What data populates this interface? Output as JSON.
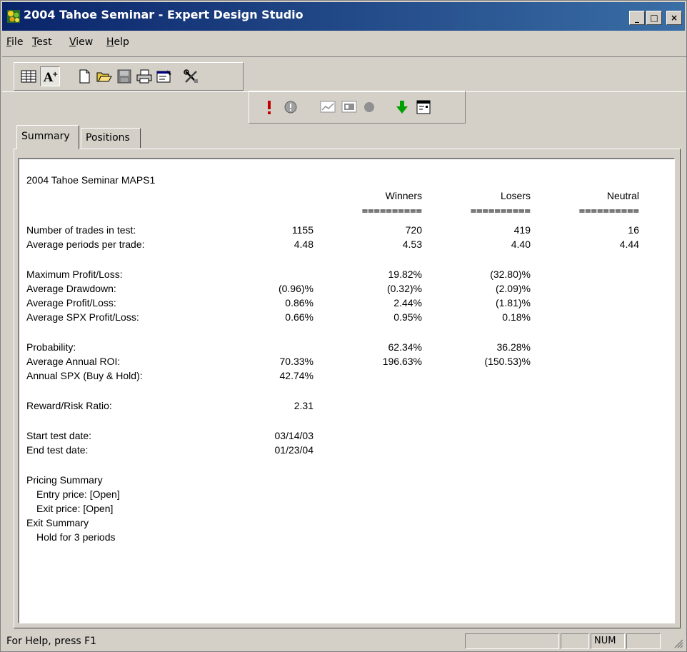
{
  "window": {
    "title": "2004 Tahoe Seminar - Expert Design Studio",
    "controls": {
      "minimize": "_",
      "maximize": "□",
      "close": "×"
    }
  },
  "menu": {
    "items": [
      {
        "label": "File",
        "mnemonic": "F",
        "rest": "ile"
      },
      {
        "label": "Test",
        "mnemonic": "T",
        "rest": "est"
      },
      {
        "label": "View",
        "mnemonic": "V",
        "rest": "iew"
      },
      {
        "label": "Help",
        "mnemonic": "H",
        "rest": "elp"
      }
    ]
  },
  "toolbar1": {
    "icons": [
      "grid-view-icon",
      "text-view-icon",
      "new-file-icon",
      "open-folder-icon",
      "save-icon",
      "print-icon",
      "properties-icon",
      "tools-icon"
    ]
  },
  "toolbar2": {
    "icons": [
      "run-alert-icon",
      "stop-icon",
      "chart-icon",
      "chart-window-icon",
      "record-icon",
      "download-arrow-icon",
      "report-icon"
    ],
    "colors": {
      "alert": "#c00000",
      "arrow": "#00a000"
    }
  },
  "tabs": [
    {
      "label": "Summary",
      "active": true
    },
    {
      "label": "Positions",
      "active": false
    }
  ],
  "report": {
    "title": "2004 Tahoe Seminar MAPS1",
    "headers": {
      "winners": "Winners",
      "losers": "Losers",
      "neutral": "Neutral"
    },
    "separator": "==========",
    "rows": {
      "trades": {
        "label": "Number of trades in test:",
        "all": "1155",
        "winners": "720",
        "losers": "419",
        "neutral": "16"
      },
      "periods": {
        "label": "Average periods per trade:",
        "all": "4.48",
        "winners": "4.53",
        "losers": "4.40",
        "neutral": "4.44"
      },
      "max_pl": {
        "label": "Maximum Profit/Loss:",
        "winners": "19.82%",
        "losers": "(32.80)%"
      },
      "avg_dd": {
        "label": "Average Drawdown:",
        "all": "(0.96)%",
        "winners": "(0.32)%",
        "losers": "(2.09)%"
      },
      "avg_pl": {
        "label": "Average Profit/Loss:",
        "all": "0.86%",
        "winners": "2.44%",
        "losers": "(1.81)%"
      },
      "avg_spx": {
        "label": "Average SPX Profit/Loss:",
        "all": "0.66%",
        "winners": "0.95%",
        "losers": "0.18%"
      },
      "prob": {
        "label": "Probability:",
        "winners": "62.34%",
        "losers": "36.28%"
      },
      "roi": {
        "label": "Average Annual ROI:",
        "all": "70.33%",
        "winners": "196.63%",
        "losers": "(150.53)%"
      },
      "spx_bh": {
        "label": "Annual SPX (Buy & Hold):",
        "all": "42.74%"
      },
      "rr": {
        "label": "Reward/Risk Ratio:",
        "all": "2.31"
      },
      "start": {
        "label": "Start test date:",
        "all": "03/14/03"
      },
      "end": {
        "label": "End test date:",
        "all": "01/23/04"
      }
    },
    "pricing": {
      "heading": "Pricing Summary",
      "entry": "Entry price: [Open]",
      "exit": "Exit price: [Open]"
    },
    "exit_summary": {
      "heading": "Exit Summary",
      "hold": "Hold for 3 periods"
    }
  },
  "status": {
    "help": "For Help, press F1",
    "num": "NUM"
  }
}
